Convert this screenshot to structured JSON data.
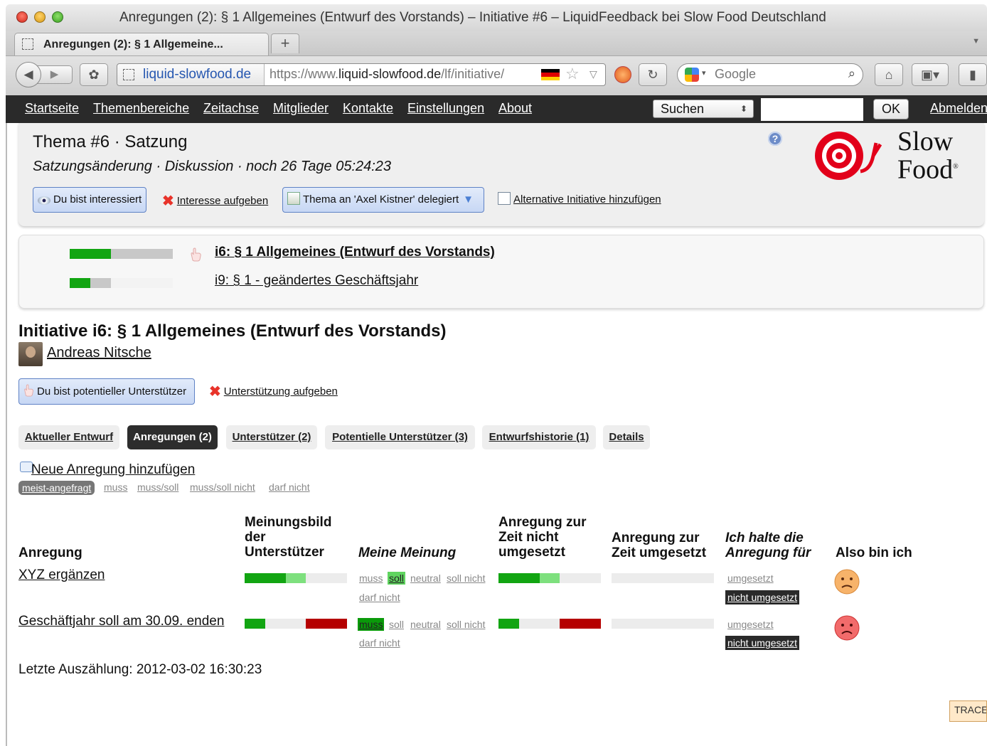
{
  "window": {
    "title": "Anregungen (2): § 1 Allgemeines (Entwurf des Vorstands) – Initiative #6 – LiquidFeedback bei Slow Food Deutschland"
  },
  "browser": {
    "tab_title": "Anregungen (2): § 1 Allgemeine...",
    "new_tab_label": "+",
    "identity": "liquid-slowfood.de",
    "url_prefix": "https://www.",
    "url_host": "liquid-slowfood.de",
    "url_path": "/lf/initiative/",
    "search_placeholder": "Google",
    "colors": {
      "flag_black": "#000000",
      "flag_red": "#dd0000",
      "flag_gold": "#ffce00"
    }
  },
  "site_menu": {
    "items": [
      "Startseite",
      "Themenbereiche",
      "Zeitachse",
      "Mitglieder",
      "Kontakte",
      "Einstellungen",
      "About"
    ],
    "search_select": "Suchen",
    "ok_label": "OK",
    "logout": "Abmelden"
  },
  "topic": {
    "title_part1": "Thema #6",
    "title_sep": " · ",
    "title_part2": "Satzung",
    "sub_link": "Satzungsänderung",
    "sub_rest": " · Diskussion · noch 26 Tage 05:24:23",
    "help_icon": "?",
    "interested_label": "Du bist interessiert",
    "drop_interest": "Interesse aufgeben",
    "delegation_label": "Thema an 'Axel Kistner' delegiert",
    "add_alternative": "Alternative Initiative hinzufügen",
    "logo_line1": "Slow",
    "logo_line2": "Food",
    "logo_mark": "®"
  },
  "initiatives_list": [
    {
      "label": "i6: § 1 Allgemeines (Entwurf des Vorstands)",
      "support": 0.4,
      "potential": 0.6,
      "current": true
    },
    {
      "label": "i9: § 1 - geändertes Geschäftsjahr",
      "support": 0.2,
      "potential": 0.2,
      "current": false
    }
  ],
  "initiative": {
    "heading": "Initiative i6: § 1 Allgemeines (Entwurf des Vorstands)",
    "author": "Andreas Nitsche",
    "support_label": "Du bist potentieller Unterstützer",
    "unsupport_label": "Unterstützung aufgeben"
  },
  "tabs": [
    {
      "label": "Aktueller Entwurf",
      "active": false
    },
    {
      "label": "Anregungen (2)",
      "active": true
    },
    {
      "label": "Unterstützer (2)",
      "active": false
    },
    {
      "label": "Potentielle Unterstützer (3)",
      "active": false
    },
    {
      "label": "Entwurfshistorie (1)",
      "active": false
    },
    {
      "label": "Details",
      "active": false
    }
  ],
  "suggestions": {
    "add_label": "Neue Anregung hinzufügen",
    "filters": [
      "meist-angefragt",
      "muss",
      "muss/soll",
      "muss/soll nicht",
      "darf nicht"
    ],
    "active_filter": "meist-angefragt",
    "headers": {
      "anregung": "Anregung",
      "meinungsbild": [
        "Meinungsbild",
        "der",
        "Unterstützer"
      ],
      "meine_meinung": "Meine Meinung",
      "nicht_umgesetzt": [
        "Anregung zur",
        "Zeit nicht",
        "umgesetzt"
      ],
      "umgesetzt": [
        "Anregung zur",
        "Zeit umgesetzt"
      ],
      "ich_halte": [
        "Ich halte die",
        "Anregung für"
      ],
      "also_bin_ich": "Also bin ich"
    },
    "opinion_options": [
      "muss",
      "soll",
      "neutral",
      "soll nicht",
      "darf nicht"
    ],
    "fulfilled_options": [
      "umgesetzt",
      "nicht umgesetzt"
    ],
    "rows": [
      {
        "title": "XYZ ergänzen",
        "opinion_bar": {
          "muss": 0.4,
          "soll": 0.2,
          "soll_nicht": 0,
          "darf_nicht": 0
        },
        "my_opinion": "soll",
        "not_fulfilled_bar": {
          "muss": 0.4,
          "soll": 0.2,
          "soll_nicht": 0,
          "darf_nicht": 0
        },
        "fulfilled_bar": {
          "muss": 0,
          "soll": 0,
          "soll_nicht": 0,
          "darf_nicht": 0
        },
        "my_fulfilled": "nicht umgesetzt",
        "mood": "unhappy"
      },
      {
        "title": "Geschäftjahr soll am 30.09. enden",
        "opinion_bar": {
          "muss": 0.2,
          "soll": 0,
          "soll_nicht": 0,
          "darf_nicht": 0.4
        },
        "my_opinion": "muss",
        "not_fulfilled_bar": {
          "muss": 0.2,
          "soll": 0,
          "soll_nicht": 0,
          "darf_nicht": 0.4
        },
        "fulfilled_bar": {
          "muss": 0,
          "soll": 0,
          "soll_nicht": 0,
          "darf_nicht": 0
        },
        "my_fulfilled": "nicht umgesetzt",
        "mood": "angry"
      }
    ]
  },
  "last_count": "Letzte Auszählung: 2012-03-02 16:30:23",
  "trace_label": "TRACE",
  "colors": {
    "green_dark": "#12a512",
    "green_light": "#7ee07e",
    "red": "#b50000",
    "bar_bg": "#ececec"
  }
}
